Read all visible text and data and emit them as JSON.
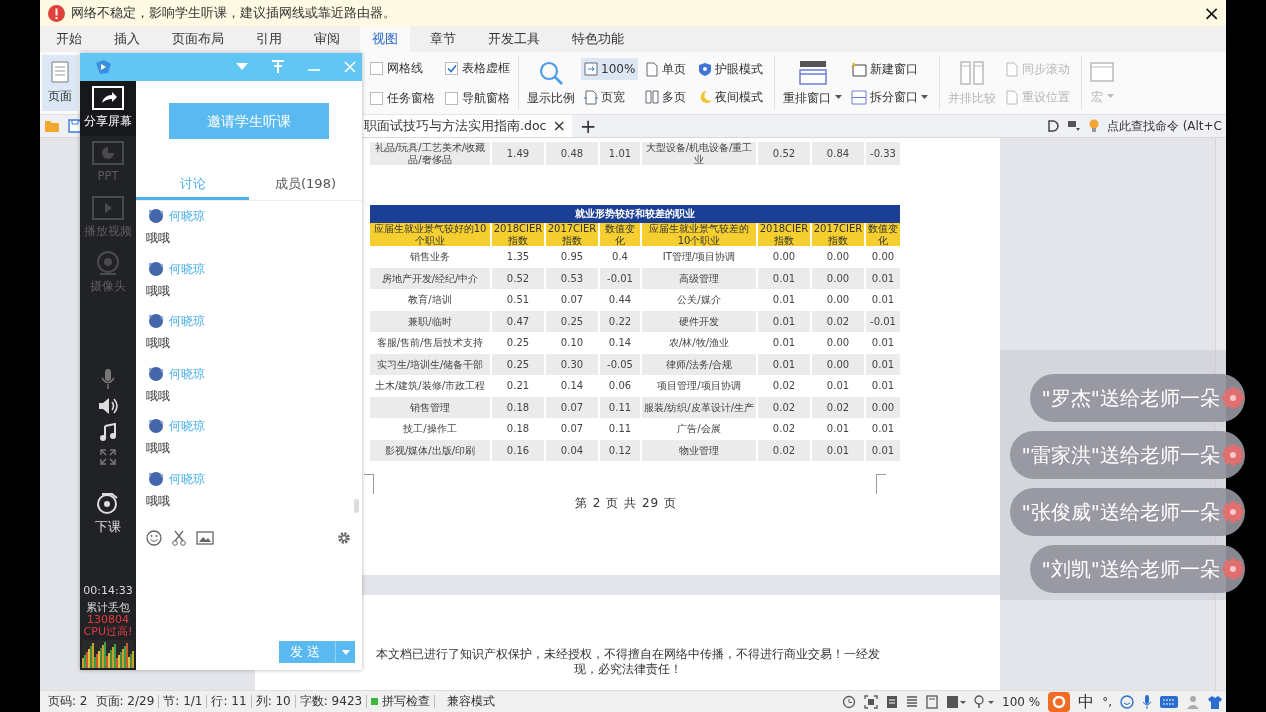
{
  "notice": {
    "text": "网络不稳定，影响学生听课，建议插网线或靠近路由器。",
    "close_label": "×"
  },
  "menu_tabs": [
    {
      "label": "开始",
      "selected": false
    },
    {
      "label": "插入",
      "selected": false
    },
    {
      "label": "页面布局",
      "selected": false
    },
    {
      "label": "引用",
      "selected": false
    },
    {
      "label": "审阅",
      "selected": false
    },
    {
      "label": "视图",
      "selected": true
    },
    {
      "label": "章节",
      "selected": false
    },
    {
      "label": "开发工具",
      "selected": false
    },
    {
      "label": "特色功能",
      "selected": false
    }
  ],
  "ribbon": {
    "page_button": {
      "label": "页面",
      "selected": true
    },
    "checkboxes": [
      {
        "label": "网格线",
        "checked": false
      },
      {
        "label": "表格虚框",
        "checked": true
      },
      {
        "label": "任务窗格",
        "checked": false
      },
      {
        "label": "导航窗格",
        "checked": false
      }
    ],
    "zoom_button": {
      "label": "显示比例"
    },
    "view_buttons": [
      {
        "label": "100%",
        "selected": true
      },
      {
        "label": "单页",
        "selected": false
      },
      {
        "label": "页宽",
        "selected": false
      },
      {
        "label": "多页",
        "selected": false
      }
    ],
    "mode_buttons": [
      {
        "label": "护眼模式"
      },
      {
        "label": "夜间模式"
      }
    ],
    "arrange_button": {
      "label": "重排窗口",
      "dropdown": true
    },
    "window_buttons": [
      {
        "label": "新建窗口",
        "dropdown": false
      },
      {
        "label": "拆分窗口",
        "dropdown": true
      }
    ],
    "compare_button": {
      "label": "并排比较",
      "disabled": true
    },
    "sync_buttons": [
      {
        "label": "同步滚动",
        "disabled": true
      },
      {
        "label": "重设位置",
        "disabled": true
      }
    ],
    "macro_button": {
      "label": "宏",
      "dropdown": true,
      "disabled": true
    }
  },
  "doc_tab": {
    "title": "职面试技巧与方法实用指南.doc",
    "close_label": "×",
    "new_tab_label": "+"
  },
  "command_search": "点此查找命令 (Alt+C",
  "document": {
    "previous_row": [
      "礼品/玩具/工艺美术/收藏品/奢侈品",
      "1.49",
      "0.48",
      "1.01",
      "大型设备/机电设备/重工业",
      "0.52",
      "0.84",
      "-0.33"
    ],
    "table": {
      "title": "就业形势较好和较差的职业",
      "columns": [
        "应届生就业景气较好的10个职业",
        "2018CIER指数",
        "2017CIER指数",
        "数值变化",
        "应届生就业景气较差的10个职业",
        "2018CIER指数",
        "2017CIER指数",
        "数值变化"
      ],
      "rows": [
        [
          "销售业务",
          "1.35",
          "0.95",
          "0.4",
          "IT管理/项目协调",
          "0.00",
          "0.00",
          "0.00"
        ],
        [
          "房地产开发/经纪/中介",
          "0.52",
          "0.53",
          "-0.01",
          "高级管理",
          "0.01",
          "0.00",
          "0.01"
        ],
        [
          "教育/培训",
          "0.51",
          "0.07",
          "0.44",
          "公关/媒介",
          "0.01",
          "0.00",
          "0.01"
        ],
        [
          "兼职/临时",
          "0.47",
          "0.25",
          "0.22",
          "硬件开发",
          "0.01",
          "0.02",
          "-0.01"
        ],
        [
          "客服/售前/售后技术支持",
          "0.25",
          "0.10",
          "0.14",
          "农/林/牧/渔业",
          "0.01",
          "0.00",
          "0.01"
        ],
        [
          "实习生/培训生/储备干部",
          "0.25",
          "0.30",
          "-0.05",
          "律师/法务/合规",
          "0.01",
          "0.00",
          "0.01"
        ],
        [
          "土木/建筑/装修/市政工程",
          "0.21",
          "0.14",
          "0.06",
          "项目管理/项目协调",
          "0.02",
          "0.01",
          "0.01"
        ],
        [
          "销售管理",
          "0.18",
          "0.07",
          "0.11",
          "服装/纺织/皮革设计/生产",
          "0.02",
          "0.02",
          "0.00"
        ],
        [
          "技工/操作工",
          "0.18",
          "0.07",
          "0.11",
          "广告/会展",
          "0.02",
          "0.01",
          "0.01"
        ],
        [
          "影视/媒体/出版/印刷",
          "0.16",
          "0.04",
          "0.12",
          "物业管理",
          "0.02",
          "0.01",
          "0.01"
        ]
      ]
    },
    "page_footer": "第 2 页 共 29 页",
    "copyright": "本文档已进行了知识产权保护，未经授权，不得擅自在网络中传播，不得进行商业交易！一经发现，必究法律责任！"
  },
  "status_bar": {
    "items": [
      "页码: 2",
      "页面: 2/29",
      "节: 1/1",
      "行: 11",
      "列: 10",
      "字数: 9423"
    ],
    "spell_check": {
      "label": "拼写检查",
      "on": true
    },
    "mode": "兼容模式",
    "zoom": "100 %",
    "ime_language": "中",
    "ime_punctuation": "°,"
  },
  "classroom_panel": {
    "sidebar": [
      {
        "label": "分享屏幕",
        "active": true
      },
      {
        "label": "PPT",
        "active": false
      },
      {
        "label": "播放视频",
        "active": false
      },
      {
        "label": "摄像头",
        "active": false
      }
    ],
    "end_class": "下课",
    "timer": "00:14:33",
    "loss_label": "累计丢包",
    "loss_count": "130804",
    "cpu_warning": "CPU过高!",
    "invite_button": "邀请学生听课",
    "tabs": [
      {
        "label": "讨论",
        "selected": true
      },
      {
        "label": "成员(198)",
        "selected": false
      }
    ],
    "messages": [
      {
        "sender": "何晓琼",
        "text": "哦哦"
      },
      {
        "sender": "何晓琼",
        "text": "哦哦"
      },
      {
        "sender": "何晓琼",
        "text": "哦哦"
      },
      {
        "sender": "何晓琼",
        "text": "哦哦"
      },
      {
        "sender": "何晓琼",
        "text": "哦哦"
      },
      {
        "sender": "何晓琼",
        "text": "哦哦"
      }
    ],
    "send_button": "发送"
  },
  "gifts": [
    {
      "text": "\"罗杰\"送给老师一朵"
    },
    {
      "text": "\"雷家洪\"送给老师一朵"
    },
    {
      "text": "\"张俊威\"送给老师一朵"
    },
    {
      "text": "\"刘凯\"送给老师一朵"
    }
  ]
}
